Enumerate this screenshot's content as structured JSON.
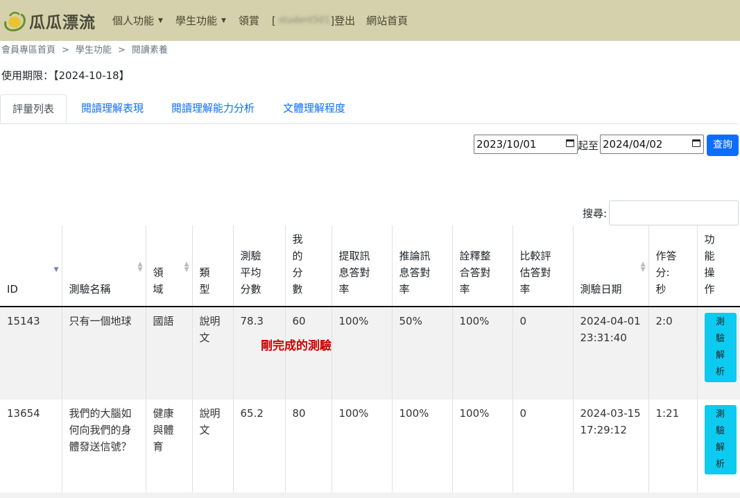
{
  "nav": {
    "logo_text": "瓜瓜漂流",
    "items": [
      {
        "label": "個人功能",
        "dropdown": true
      },
      {
        "label": "學生功能",
        "dropdown": true
      },
      {
        "label": "領賞",
        "dropdown": false
      }
    ],
    "user_open": "[",
    "username": "student501",
    "user_close": "]",
    "logout": "登出",
    "home": "網站首頁"
  },
  "breadcrumb": [
    "會員專區首頁",
    "學生功能",
    "閱讀素養"
  ],
  "breadcrumb_sep": ">",
  "expiry_text": "使用期限：【2024-10-18】",
  "tabs": [
    "評量列表",
    "閱讀理解表現",
    "閱讀理解能力分析",
    "文體理解程度"
  ],
  "filter": {
    "start_date": "2023/10/01",
    "sep": "起至",
    "end_date": "2024/04/02",
    "query_label": "查詢"
  },
  "search_label": "搜尋:",
  "table": {
    "columns": [
      "ID",
      "測驗名稱",
      "領域",
      "類型",
      "測驗平均分數",
      "我的分數",
      "提取訊息答對率",
      "推論訊息答對率",
      "詮釋整合答對率",
      "比較評估答對率",
      "測驗日期",
      "作答分:秒",
      "功能操作"
    ],
    "rows": [
      {
        "id": "15143",
        "name": "只有一個地球",
        "domain": "國語",
        "type": "說明文",
        "avg": "78.3",
        "mine": "60",
        "extract": "100%",
        "infer": "50%",
        "interpret": "100%",
        "compare": "0",
        "date": "2024-04-01 23:31:40",
        "time": "2:0",
        "action": "測驗解析"
      },
      {
        "id": "13654",
        "name": "我們的大腦如何向我們的身體發送信號？",
        "domain": "健康與體育",
        "type": "說明文",
        "avg": "65.2",
        "mine": "80",
        "extract": "100%",
        "infer": "100%",
        "interpret": "100%",
        "compare": "0",
        "date": "2024-03-15 17:29:12",
        "time": "1:21",
        "action": "測驗解析"
      }
    ]
  },
  "annotation": "剛完成的測驗",
  "colors": {
    "navbar": "#d5d1ac",
    "primary": "#0d6efd",
    "info": "#0dcaf0",
    "annotation": "#cc0000"
  }
}
